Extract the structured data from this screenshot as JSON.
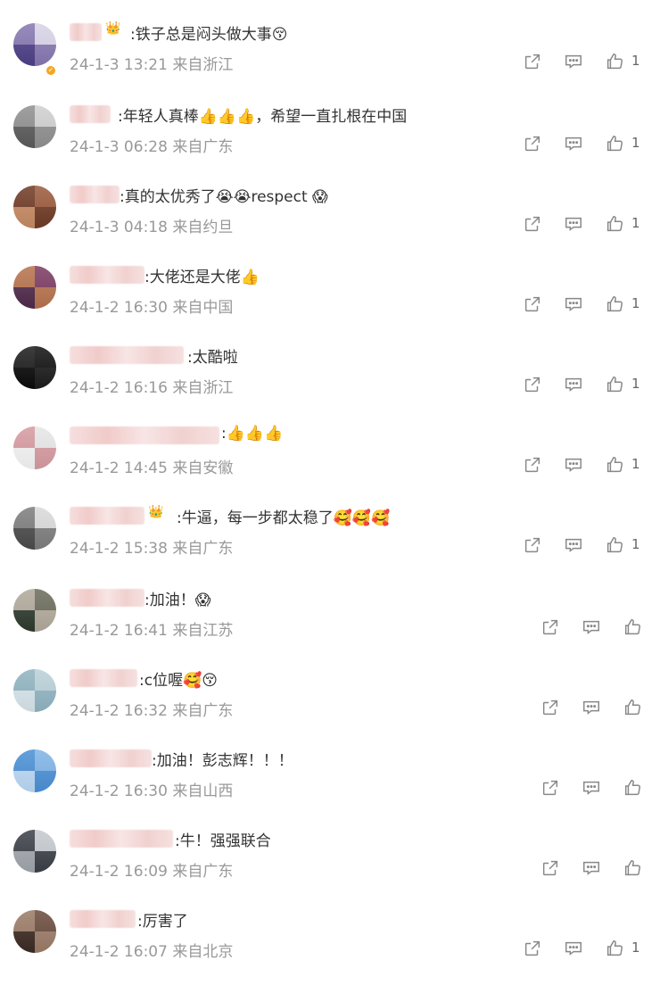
{
  "comments": [
    {
      "text": ":铁子总是闷头做大事😚",
      "time": "24-1-3 13:21",
      "loc": "来自浙江",
      "likes": "1",
      "badge": true,
      "crown": true
    },
    {
      "text": ":年轻人真棒👍👍👍，希望一直扎根在中国",
      "time": "24-1-3 06:28",
      "loc": "来自广东",
      "likes": "1"
    },
    {
      "text": ":真的太优秀了😭😭respect 😱",
      "time": "24-1-3 04:18",
      "loc": "来自约旦",
      "likes": "1"
    },
    {
      "text": ":大佬还是大佬👍",
      "time": "24-1-2 16:30",
      "loc": "来自中国",
      "likes": "1"
    },
    {
      "text": ":太酷啦",
      "time": "24-1-2 16:16",
      "loc": "来自浙江",
      "likes": "1"
    },
    {
      "text": ":👍👍👍",
      "time": "24-1-2 14:45",
      "loc": "来自安徽",
      "likes": "1"
    },
    {
      "text": ":牛逼，每一步都太稳了🥰🥰🥰",
      "time": "24-1-2 15:38",
      "loc": "来自广东",
      "likes": "1",
      "crown": true
    },
    {
      "text": ":加油！😱",
      "time": "24-1-2 16:41",
      "loc": "来自江苏",
      "likes": ""
    },
    {
      "text": ":c位喔🥰😚",
      "time": "24-1-2 16:32",
      "loc": "来自广东",
      "likes": ""
    },
    {
      "text": ":加油！彭志辉！！！",
      "time": "24-1-2 16:30",
      "loc": "来自山西",
      "likes": ""
    },
    {
      "text": ":牛！强强联合",
      "time": "24-1-2 16:09",
      "loc": "来自广东",
      "likes": ""
    },
    {
      "text": ":厉害了",
      "time": "24-1-2 16:07",
      "loc": "来自北京",
      "likes": "1"
    }
  ],
  "icons": {
    "share": "share-icon",
    "comment": "comment-icon",
    "like": "thumbs-up-icon"
  },
  "colors": {
    "meta": "#999999",
    "text": "#333333",
    "icon": "#888888"
  }
}
